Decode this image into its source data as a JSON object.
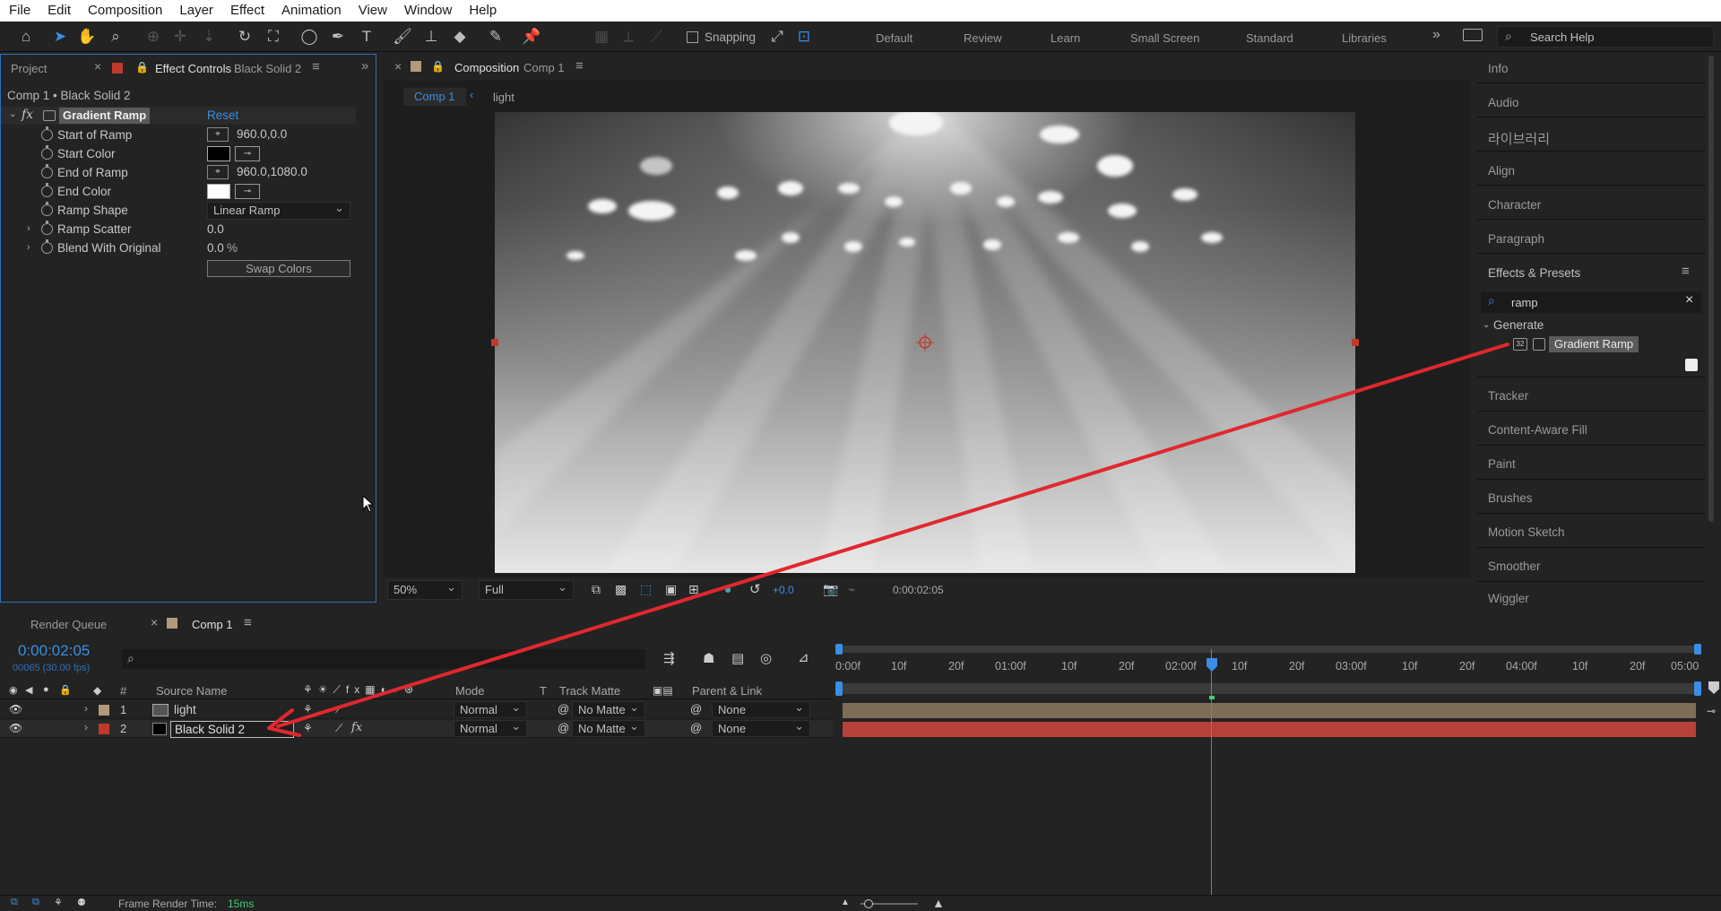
{
  "menu": [
    "File",
    "Edit",
    "Composition",
    "Layer",
    "Effect",
    "Animation",
    "View",
    "Window",
    "Help"
  ],
  "toolbar": {
    "snapping_label": "Snapping",
    "workspaces": [
      "Default",
      "Review",
      "Learn",
      "Small Screen",
      "Standard",
      "Libraries"
    ],
    "search_placeholder": "Search Help"
  },
  "effect_controls": {
    "tab_project": "Project",
    "tab_label": "Effect Controls",
    "tab_layer": "Black Solid 2",
    "breadcrumb": "Comp 1 • Black Solid 2",
    "fx_label": "fx",
    "effect_name": "Gradient Ramp",
    "reset_label": "Reset",
    "props": {
      "start_of_ramp": "Start of Ramp",
      "start_of_ramp_value": "960.0,0.0",
      "start_color": "Start Color",
      "end_of_ramp": "End of Ramp",
      "end_of_ramp_value": "960.0,1080.0",
      "end_color": "End Color",
      "ramp_shape": "Ramp Shape",
      "ramp_shape_value": "Linear Ramp",
      "ramp_scatter": "Ramp Scatter",
      "ramp_scatter_value": "0.0",
      "blend": "Blend With Original",
      "blend_value": "0.0",
      "blend_unit": "%",
      "swap_colors": "Swap Colors"
    }
  },
  "composition": {
    "tab_label": "Composition",
    "tab_comp": "Comp 1",
    "crumb_comp": "Comp 1",
    "crumb_layer": "light",
    "zoom": "50%",
    "resolution": "Full",
    "exposure": "+0.0",
    "timecode": "0:00:02:05"
  },
  "right_panels": {
    "items_top": [
      "Info",
      "Audio",
      "라이브러리",
      "Align",
      "Character",
      "Paragraph"
    ],
    "effects_presets_label": "Effects & Presets",
    "search_value": "ramp",
    "category": "Generate",
    "result": "Gradient Ramp",
    "bit_badge": "32",
    "items_bottom": [
      "Tracker",
      "Content-Aware Fill",
      "Paint",
      "Brushes",
      "Motion Sketch",
      "Smoother",
      "Wiggler"
    ]
  },
  "timeline": {
    "tab_render_queue": "Render Queue",
    "tab_comp": "Comp 1",
    "timecode": "0:00:02:05",
    "frame_info": "00065 (30.00 fps)",
    "headers": {
      "num": "#",
      "source_name": "Source Name",
      "mode": "Mode",
      "t": "T",
      "track_matte": "Track Matte",
      "parent_link": "Parent & Link"
    },
    "layers": [
      {
        "num": "1",
        "name": "light",
        "mode": "Normal",
        "matte": "No Matte",
        "parent": "None"
      },
      {
        "num": "2",
        "name": "Black Solid 2",
        "mode": "Normal",
        "matte": "No Matte",
        "parent": "None"
      }
    ],
    "ruler": [
      "0:00f",
      "10f",
      "20f",
      "01:00f",
      "10f",
      "20f",
      "02:00f",
      "10f",
      "20f",
      "03:00f",
      "10f",
      "20f",
      "04:00f",
      "10f",
      "20f",
      "05:00"
    ],
    "render_time_label": "Frame Render Time:",
    "render_time_value": "15ms"
  },
  "colors": {
    "accent": "#3a8ee6",
    "layer1_label": "#b39a7a",
    "layer2_label": "#c0392b",
    "annotation_arrow": "#e0282e"
  }
}
